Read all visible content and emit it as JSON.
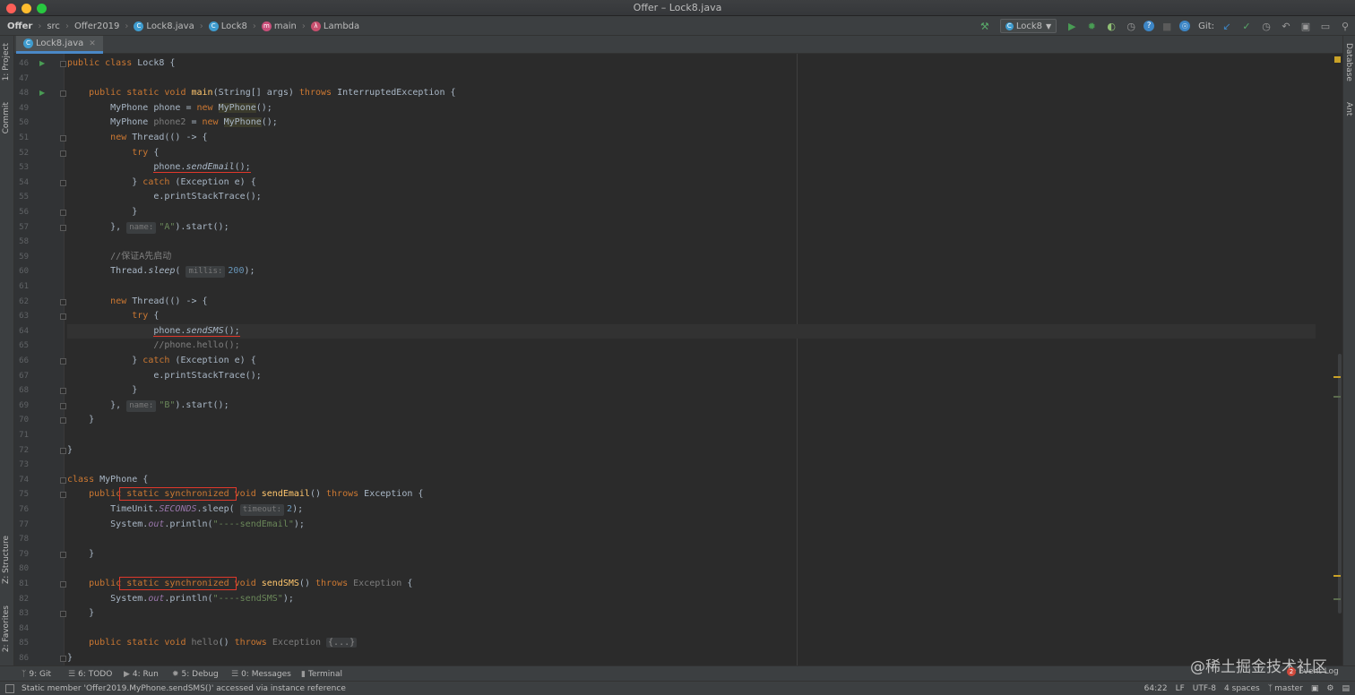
{
  "window": {
    "title": "Offer – Lock8.java",
    "traffic_colors": [
      "#ff5f57",
      "#febc2e",
      "#28c840"
    ]
  },
  "navbar": {
    "breadcrumbs": [
      {
        "label": "Offer",
        "icon": "project-folder-icon",
        "bold": true
      },
      {
        "label": "src",
        "icon": "source-folder-icon"
      },
      {
        "label": "Offer2019",
        "icon": "package-icon"
      },
      {
        "label": "Lock8.java",
        "icon": "java-class-icon"
      },
      {
        "label": "Lock8",
        "icon": "class-icon"
      },
      {
        "label": "main",
        "icon": "method-icon"
      },
      {
        "label": "Lambda",
        "icon": "lambda-icon"
      }
    ],
    "run_config": "Lock8",
    "git_label": "Git:"
  },
  "tab": {
    "label": "Lock8.java"
  },
  "left_tools": [
    "1: Project",
    "Commit",
    "Z: Structure",
    "2: Favorites"
  ],
  "right_tools": [
    "Database",
    "Ant"
  ],
  "editor": {
    "line_numbers": [
      "46",
      "47",
      "48",
      "49",
      "50",
      "51",
      "52",
      "53",
      "54",
      "55",
      "56",
      "57",
      "58",
      "59",
      "60",
      "61",
      "62",
      "63",
      "64",
      "65",
      "66",
      "67",
      "68",
      "69",
      "70",
      "71",
      "72",
      "73",
      "74",
      "75",
      "76",
      "77",
      "78",
      "79",
      "80",
      "81",
      "82",
      "83",
      "84",
      "85",
      "86"
    ],
    "current_line": "64",
    "lines": [
      {
        "n": "46",
        "spans": [
          {
            "c": "k",
            "t": "public class "
          },
          {
            "c": "t",
            "t": "Lock8 {"
          }
        ]
      },
      {
        "n": "47",
        "spans": []
      },
      {
        "n": "48",
        "spans": [
          {
            "c": "t",
            "t": "    "
          },
          {
            "c": "k",
            "t": "public static void "
          },
          {
            "c": "fn",
            "t": "main"
          },
          {
            "c": "t",
            "t": "(String[] args) "
          },
          {
            "c": "k",
            "t": "throws "
          },
          {
            "c": "t",
            "t": "InterruptedException {"
          }
        ]
      },
      {
        "n": "49",
        "spans": [
          {
            "c": "t",
            "t": "        MyPhone phone = "
          },
          {
            "c": "k",
            "t": "new "
          },
          {
            "c": "t hl",
            "t": "MyPhone"
          },
          {
            "c": "t",
            "t": "();"
          }
        ]
      },
      {
        "n": "50",
        "spans": [
          {
            "c": "t",
            "t": "        MyPhone "
          },
          {
            "c": "unused",
            "t": "phone2"
          },
          {
            "c": "t",
            "t": " = "
          },
          {
            "c": "k",
            "t": "new "
          },
          {
            "c": "t hl",
            "t": "MyPhone"
          },
          {
            "c": "t",
            "t": "();"
          }
        ]
      },
      {
        "n": "51",
        "spans": [
          {
            "c": "t",
            "t": "        "
          },
          {
            "c": "k",
            "t": "new "
          },
          {
            "c": "t",
            "t": "Thread(() -> {"
          }
        ]
      },
      {
        "n": "52",
        "spans": [
          {
            "c": "t",
            "t": "            "
          },
          {
            "c": "k",
            "t": "try "
          },
          {
            "c": "t",
            "t": "{"
          }
        ]
      },
      {
        "n": "53",
        "spans": [
          {
            "c": "t",
            "t": "                "
          },
          {
            "c": "t redline",
            "t": "phone."
          },
          {
            "c": "t ital redline",
            "t": "sendEmail"
          },
          {
            "c": "t redline",
            "t": "();"
          }
        ]
      },
      {
        "n": "54",
        "spans": [
          {
            "c": "t",
            "t": "            } "
          },
          {
            "c": "k",
            "t": "catch "
          },
          {
            "c": "t",
            "t": "(Exception e) {"
          }
        ]
      },
      {
        "n": "55",
        "spans": [
          {
            "c": "t",
            "t": "                e.printStackTrace();"
          }
        ]
      },
      {
        "n": "56",
        "spans": [
          {
            "c": "t",
            "t": "            }"
          }
        ]
      },
      {
        "n": "57",
        "spans": [
          {
            "c": "t",
            "t": "        }, "
          },
          {
            "c": "inlay",
            "t": "name:"
          },
          {
            "c": "s",
            "t": "\"A\""
          },
          {
            "c": "t",
            "t": ").start();"
          }
        ]
      },
      {
        "n": "58",
        "spans": []
      },
      {
        "n": "59",
        "spans": [
          {
            "c": "cm",
            "t": "        //保证A先启动"
          }
        ]
      },
      {
        "n": "60",
        "spans": [
          {
            "c": "t",
            "t": "        Thread."
          },
          {
            "c": "t ital",
            "t": "sleep"
          },
          {
            "c": "t",
            "t": "( "
          },
          {
            "c": "inlay",
            "t": "millis:"
          },
          {
            "c": "n",
            "t": "200"
          },
          {
            "c": "t",
            "t": ");"
          }
        ]
      },
      {
        "n": "61",
        "spans": []
      },
      {
        "n": "62",
        "spans": [
          {
            "c": "t",
            "t": "        "
          },
          {
            "c": "k",
            "t": "new "
          },
          {
            "c": "t",
            "t": "Thread(() -> {"
          }
        ]
      },
      {
        "n": "63",
        "spans": [
          {
            "c": "t",
            "t": "            "
          },
          {
            "c": "k",
            "t": "try "
          },
          {
            "c": "t",
            "t": "{"
          }
        ]
      },
      {
        "n": "64",
        "spans": [
          {
            "c": "t",
            "t": "                "
          },
          {
            "c": "t redline",
            "t": "phone."
          },
          {
            "c": "t ital redline",
            "t": "sendSMS"
          },
          {
            "c": "t redline",
            "t": "();"
          }
        ]
      },
      {
        "n": "65",
        "spans": [
          {
            "c": "cm",
            "t": "                //phone.hello();"
          }
        ]
      },
      {
        "n": "66",
        "spans": [
          {
            "c": "t",
            "t": "            } "
          },
          {
            "c": "k",
            "t": "catch "
          },
          {
            "c": "t",
            "t": "(Exception e) {"
          }
        ]
      },
      {
        "n": "67",
        "spans": [
          {
            "c": "t",
            "t": "                e.printStackTrace();"
          }
        ]
      },
      {
        "n": "68",
        "spans": [
          {
            "c": "t",
            "t": "            }"
          }
        ]
      },
      {
        "n": "69",
        "spans": [
          {
            "c": "t",
            "t": "        }, "
          },
          {
            "c": "inlay",
            "t": "name:"
          },
          {
            "c": "s",
            "t": "\"B\""
          },
          {
            "c": "t",
            "t": ").start();"
          }
        ]
      },
      {
        "n": "70",
        "spans": [
          {
            "c": "t",
            "t": "    }"
          }
        ]
      },
      {
        "n": "71",
        "spans": []
      },
      {
        "n": "72",
        "spans": [
          {
            "c": "t",
            "t": "}"
          }
        ]
      },
      {
        "n": "73",
        "spans": []
      },
      {
        "n": "74",
        "spans": [
          {
            "c": "k",
            "t": "class "
          },
          {
            "c": "t",
            "t": "MyPhone {"
          }
        ]
      },
      {
        "n": "75",
        "spans": [
          {
            "c": "t",
            "t": "    "
          },
          {
            "c": "k",
            "t": "public"
          },
          {
            "c": "k redbox",
            "t": " static synchronized "
          },
          {
            "c": "k",
            "t": "void "
          },
          {
            "c": "fn",
            "t": "sendEmail"
          },
          {
            "c": "t",
            "t": "() "
          },
          {
            "c": "k",
            "t": "throws "
          },
          {
            "c": "t",
            "t": "Exception {"
          }
        ]
      },
      {
        "n": "76",
        "spans": [
          {
            "c": "t",
            "t": "        TimeUnit."
          },
          {
            "c": "field",
            "t": "SECONDS"
          },
          {
            "c": "t",
            "t": ".sleep( "
          },
          {
            "c": "inlay",
            "t": "timeout:"
          },
          {
            "c": "n",
            "t": "2"
          },
          {
            "c": "t",
            "t": ");"
          }
        ]
      },
      {
        "n": "77",
        "spans": [
          {
            "c": "t",
            "t": "        System."
          },
          {
            "c": "field",
            "t": "out"
          },
          {
            "c": "t",
            "t": ".println("
          },
          {
            "c": "s",
            "t": "\"----sendEmail\""
          },
          {
            "c": "t",
            "t": ");"
          }
        ]
      },
      {
        "n": "78",
        "spans": []
      },
      {
        "n": "79",
        "spans": [
          {
            "c": "t",
            "t": "    }"
          }
        ]
      },
      {
        "n": "80",
        "spans": []
      },
      {
        "n": "81",
        "spans": [
          {
            "c": "t",
            "t": "    "
          },
          {
            "c": "k",
            "t": "public"
          },
          {
            "c": "k redbox",
            "t": " static synchronized "
          },
          {
            "c": "k",
            "t": "void "
          },
          {
            "c": "fn",
            "t": "sendSMS"
          },
          {
            "c": "t",
            "t": "() "
          },
          {
            "c": "k",
            "t": "throws "
          },
          {
            "c": "unused",
            "t": "Exception"
          },
          {
            "c": "t",
            "t": " {"
          }
        ]
      },
      {
        "n": "82",
        "spans": [
          {
            "c": "t",
            "t": "        System."
          },
          {
            "c": "field",
            "t": "out"
          },
          {
            "c": "t",
            "t": ".println("
          },
          {
            "c": "s",
            "t": "\"----sendSMS\""
          },
          {
            "c": "t",
            "t": ");"
          }
        ]
      },
      {
        "n": "83",
        "spans": [
          {
            "c": "t",
            "t": "    }"
          }
        ]
      },
      {
        "n": "84",
        "spans": []
      },
      {
        "n": "85",
        "spans": [
          {
            "c": "t",
            "t": "    "
          },
          {
            "c": "k",
            "t": "public static void "
          },
          {
            "c": "unused",
            "t": "hello"
          },
          {
            "c": "t",
            "t": "() "
          },
          {
            "c": "k",
            "t": "throws "
          },
          {
            "c": "unused",
            "t": "Exception"
          },
          {
            "c": "t",
            "t": " "
          },
          {
            "c": "folded",
            "t": "{...}"
          }
        ]
      },
      {
        "n": "86",
        "spans": [
          {
            "c": "t",
            "t": "}"
          }
        ]
      }
    ]
  },
  "bottom_tools": [
    {
      "label": "9: Git",
      "icon": "git-icon"
    },
    {
      "label": "6: TODO",
      "icon": "todo-icon"
    },
    {
      "label": "4: Run",
      "icon": "run-icon"
    },
    {
      "label": "5: Debug",
      "icon": "debug-icon"
    },
    {
      "label": "0: Messages",
      "icon": "messages-icon"
    },
    {
      "label": "Terminal",
      "icon": "terminal-icon"
    }
  ],
  "status": {
    "message": "Static member 'Offer2019.MyPhone.sendSMS()' accessed via instance reference",
    "position": "64:22",
    "line_sep": "LF",
    "encoding": "UTF-8",
    "indent": "4 spaces",
    "branch": "master",
    "event_log": "Event Log",
    "event_count": "2"
  },
  "watermark": "@稀土掘金技术社区"
}
